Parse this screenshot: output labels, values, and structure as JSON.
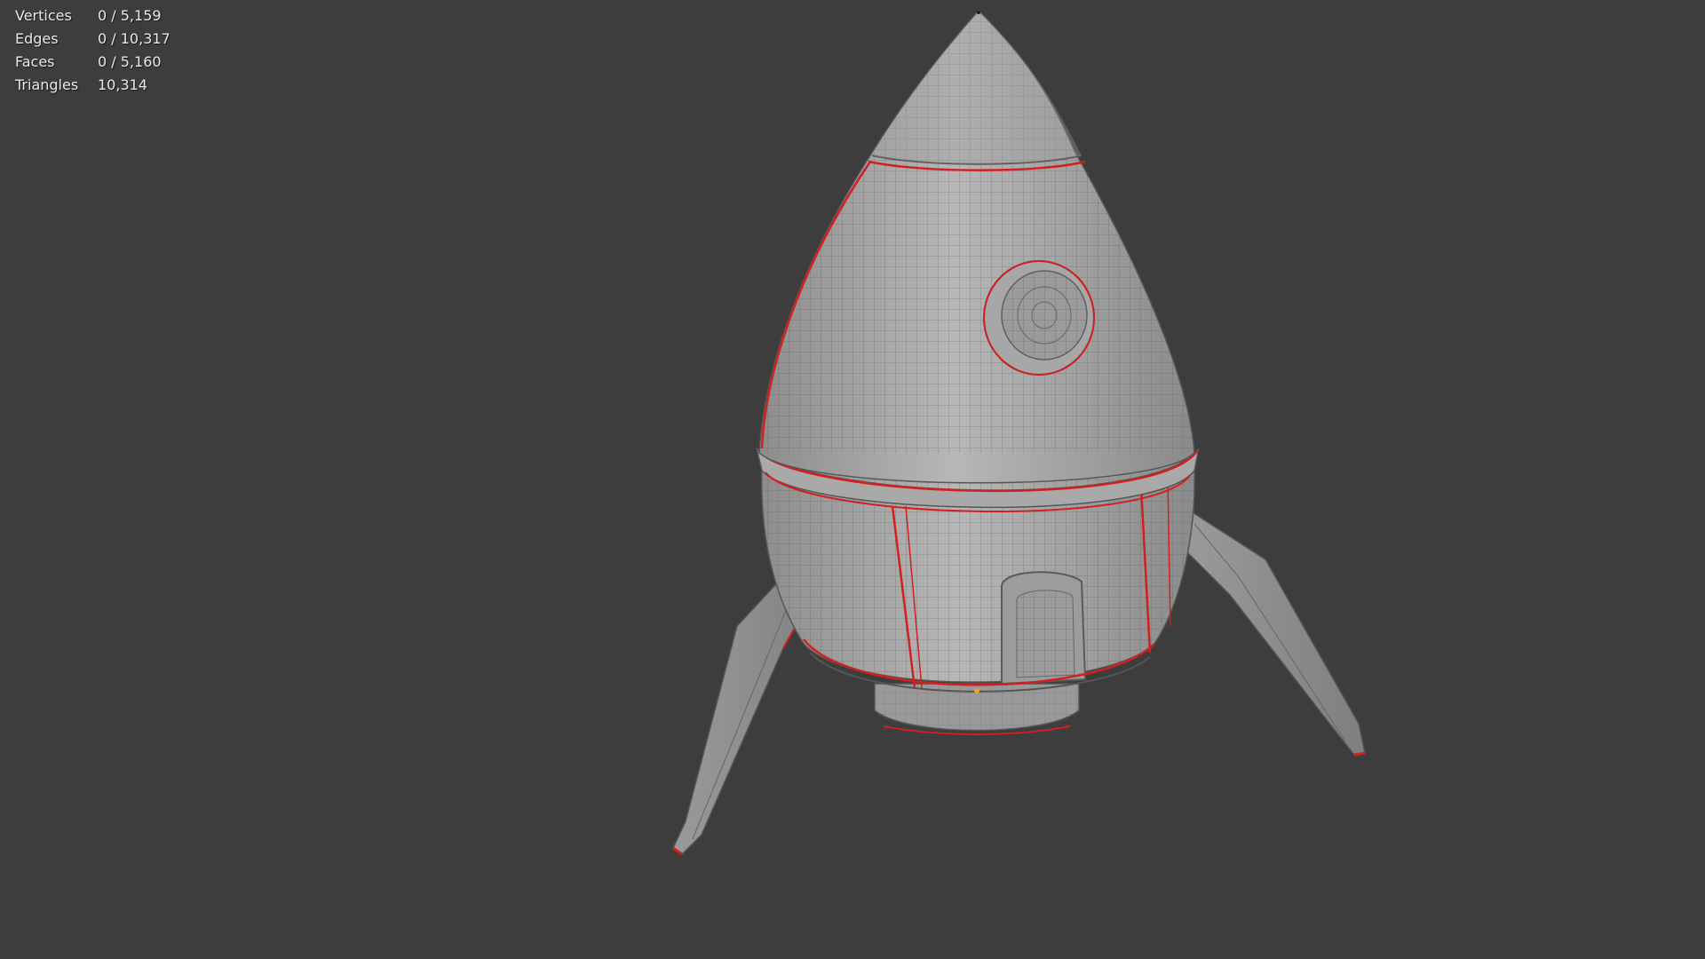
{
  "viewport": {
    "background_color": "#3d3d3d",
    "seam_color": "#d21f1f",
    "mesh_color": "#a6a6a6"
  },
  "stats": [
    {
      "label": "Vertices",
      "value": "0 / 5,159"
    },
    {
      "label": "Edges",
      "value": "0 / 10,317"
    },
    {
      "label": "Faces",
      "value": "0 / 5,160"
    },
    {
      "label": "Triangles",
      "value": "10,314"
    }
  ]
}
